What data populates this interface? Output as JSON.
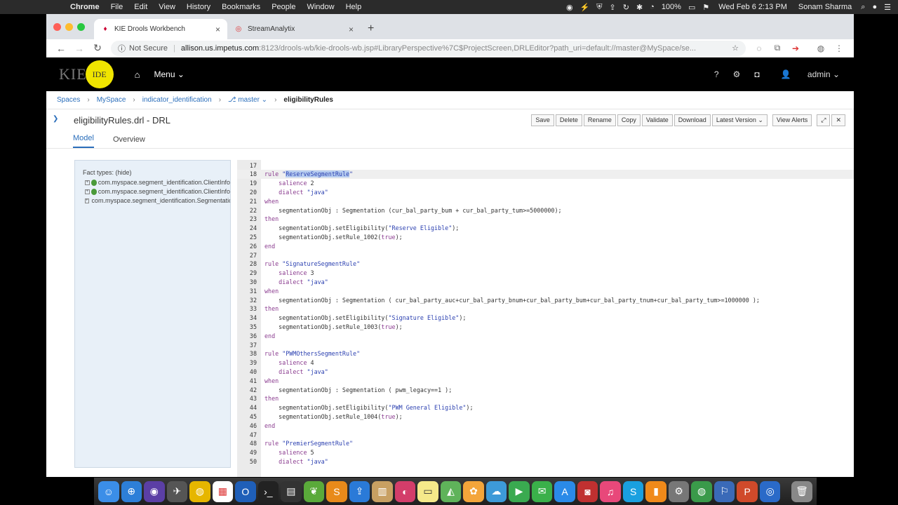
{
  "menubar": {
    "apple": "",
    "app": "Chrome",
    "items": [
      "File",
      "Edit",
      "View",
      "History",
      "Bookmarks",
      "People",
      "Window",
      "Help"
    ],
    "battery": "100%",
    "datetime": "Wed Feb 6  2:13 PM",
    "user": "Sonam Sharma"
  },
  "browser": {
    "tabs": [
      {
        "title": "KIE Drools Workbench",
        "active": true
      },
      {
        "title": "StreamAnalytix",
        "active": false
      }
    ],
    "security": "Not Secure",
    "url_host": "allison.us.impetus.com",
    "url_path": ":8123/drools-wb/kie-drools-wb.jsp#LibraryPerspective%7C$ProjectScreen,DRLEditor?path_uri=default://master@MySpace/se..."
  },
  "kie": {
    "logo": "KIE",
    "ide": "IDE",
    "menu": "Menu ⌄",
    "help": "?",
    "user": "admin ⌄"
  },
  "breadcrumb": {
    "spaces": "Spaces",
    "myspace": "MySpace",
    "project": "indicator_identification",
    "branch": "⎇ master ⌄",
    "current": "eligibilityRules"
  },
  "editor": {
    "title": "eligibilityRules.drl - DRL",
    "toolbar": [
      "Save",
      "Delete",
      "Rename",
      "Copy",
      "Validate",
      "Download",
      "Latest Version ⌄"
    ],
    "view_alerts": "View Alerts",
    "tabs": [
      "Model",
      "Overview"
    ]
  },
  "facts": {
    "header": "Fact types: (hide)",
    "items": [
      "com.myspace.segment_identification.ClientInfo",
      "com.myspace.segment_identification.ClientInfo",
      "com.myspace.segment_identification.Segmentation"
    ]
  },
  "code": [
    {
      "n": "17",
      "t": ""
    },
    {
      "n": "18",
      "t": "rule \"ReserveSegmentRule\""
    },
    {
      "n": "19",
      "t": "    salience 2"
    },
    {
      "n": "20",
      "t": "    dialect \"java\""
    },
    {
      "n": "21",
      "t": "when"
    },
    {
      "n": "22",
      "t": "    segmentationObj : Segmentation (cur_bal_party_bum + cur_bal_party_tum>=5000000);"
    },
    {
      "n": "23",
      "t": "then"
    },
    {
      "n": "24",
      "t": "    segmentationObj.setEligibility(\"Reserve Eligible\");"
    },
    {
      "n": "25",
      "t": "    segmentationObj.setRule_1002(true);"
    },
    {
      "n": "26",
      "t": "end"
    },
    {
      "n": "27",
      "t": ""
    },
    {
      "n": "28",
      "t": "rule \"SignatureSegmentRule\""
    },
    {
      "n": "29",
      "t": "    salience 3"
    },
    {
      "n": "30",
      "t": "    dialect \"java\""
    },
    {
      "n": "31",
      "t": "when"
    },
    {
      "n": "32",
      "t": "    segmentationObj : Segmentation ( cur_bal_party_auc+cur_bal_party_bnum+cur_bal_party_bum+cur_bal_party_tnum+cur_bal_party_tum>=1000000 );"
    },
    {
      "n": "33",
      "t": "then"
    },
    {
      "n": "34",
      "t": "    segmentationObj.setEligibility(\"Signature Eligible\");"
    },
    {
      "n": "35",
      "t": "    segmentationObj.setRule_1003(true);"
    },
    {
      "n": "36",
      "t": "end"
    },
    {
      "n": "37",
      "t": ""
    },
    {
      "n": "38",
      "t": "rule \"PWMOthersSegmentRule\""
    },
    {
      "n": "39",
      "t": "    salience 4"
    },
    {
      "n": "40",
      "t": "    dialect \"java\""
    },
    {
      "n": "41",
      "t": "when"
    },
    {
      "n": "42",
      "t": "    segmentationObj : Segmentation ( pwm_legacy==1 );"
    },
    {
      "n": "43",
      "t": "then"
    },
    {
      "n": "44",
      "t": "    segmentationObj.setEligibility(\"PWM General Eligible\");"
    },
    {
      "n": "45",
      "t": "    segmentationObj.setRule_1004(true);"
    },
    {
      "n": "46",
      "t": "end"
    },
    {
      "n": "47",
      "t": ""
    },
    {
      "n": "48",
      "t": "rule \"PremierSegmentRule\""
    },
    {
      "n": "49",
      "t": "    salience 5"
    },
    {
      "n": "50",
      "t": "    dialect \"java\""
    }
  ],
  "colors": {
    "kie_yellow": "#f0e500",
    "link_blue": "#2a6ebb",
    "facts_bg": "#e8f0f8"
  }
}
